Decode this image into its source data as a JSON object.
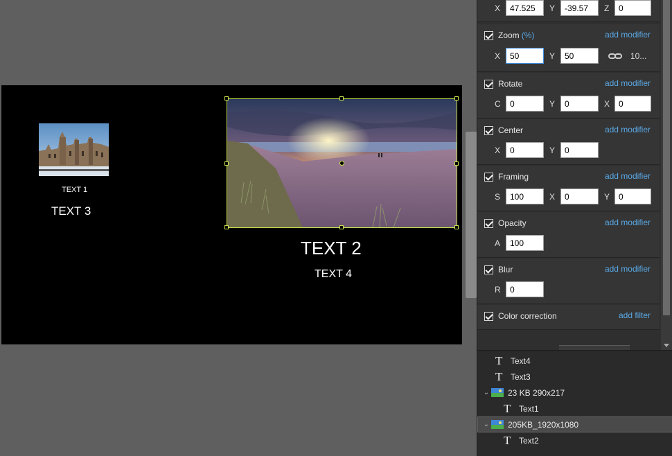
{
  "canvas": {
    "texts": {
      "text1": "TEXT 1",
      "text2": "TEXT 2",
      "text3": "TEXT 3",
      "text4": "TEXT 4"
    }
  },
  "properties": {
    "position": {
      "x": "47.525",
      "y": "-39.57",
      "z": "0",
      "labels": [
        "X",
        "Y",
        "Z"
      ]
    },
    "zoom": {
      "title": "Zoom",
      "unit": "(%)",
      "add": "add modifier",
      "x": "50",
      "y": "50",
      "labels": [
        "X",
        "Y"
      ],
      "linked_value": "10..."
    },
    "rotate": {
      "title": "Rotate",
      "add": "add modifier",
      "c": "0",
      "y": "0",
      "x": "0",
      "labels": [
        "C",
        "Y",
        "X"
      ]
    },
    "center": {
      "title": "Center",
      "add": "add modifier",
      "x": "0",
      "y": "0",
      "labels": [
        "X",
        "Y"
      ]
    },
    "framing": {
      "title": "Framing",
      "add": "add modifier",
      "s": "100",
      "x": "0",
      "y": "0",
      "labels": [
        "S",
        "X",
        "Y"
      ]
    },
    "opacity": {
      "title": "Opacity",
      "add": "add modifier",
      "a": "100",
      "labels": [
        "A"
      ]
    },
    "blur": {
      "title": "Blur",
      "add": "add modifier",
      "r": "0",
      "labels": [
        "R"
      ]
    },
    "color_correction": {
      "title": "Color correction",
      "add": "add filter"
    }
  },
  "layers": [
    {
      "name": "Text4",
      "type": "text",
      "icon": "text-icon"
    },
    {
      "name": "Text3",
      "type": "text",
      "icon": "text-icon"
    },
    {
      "name": "23 KB 290x217",
      "type": "image",
      "icon": "image-icon",
      "expanded": true
    },
    {
      "name": "Text1",
      "type": "text",
      "icon": "text-icon"
    },
    {
      "name": "205KB_1920x1080",
      "type": "image",
      "icon": "image-icon",
      "expanded": true,
      "selected": true
    },
    {
      "name": "Text2",
      "type": "text",
      "icon": "text-icon"
    }
  ],
  "colors": {
    "selection": "#c8e04a",
    "link": "#5aa9e6",
    "focus": "#3d8ee0"
  }
}
